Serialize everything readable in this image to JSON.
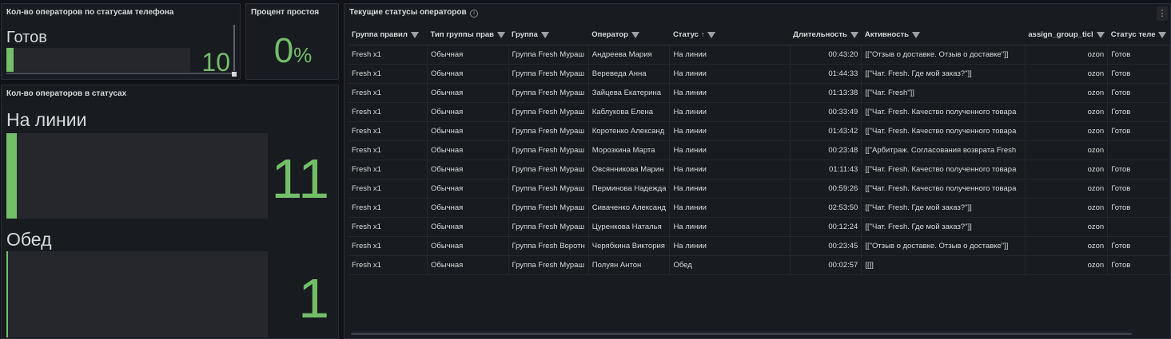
{
  "phone_panel": {
    "title": "Кол-во операторов по статусам телефона",
    "label": "Готов",
    "value": "10",
    "fill": 0.02
  },
  "idle_panel": {
    "title": "Процент простоя",
    "value": "0",
    "unit": "%"
  },
  "status_panel": {
    "title": "Кол-во операторов в статусах",
    "items": [
      {
        "label": "На линии",
        "value": "11",
        "fill": 0.04
      },
      {
        "label": "Обед",
        "value": "1",
        "fill": 0.004
      }
    ]
  },
  "table_panel": {
    "title": "Текущие статусы операторов",
    "info_icon": "info-icon",
    "columns": [
      "Группа правил",
      "Тип группы прав",
      "Группа",
      "Оператор",
      "Статус",
      "Длительность",
      "Активность",
      "assign_group_ticl",
      "Статус теле"
    ],
    "sort_column": "Статус",
    "rows": [
      [
        "Fresh x1",
        "Обычная",
        "Группа Fresh Мураш",
        "Андреева Мария",
        "На линии",
        "00:43:20",
        "[[\"Отзыв о доставке. Отзыв о доставке\"]]",
        "ozon",
        "Готов"
      ],
      [
        "Fresh x1",
        "Обычная",
        "Группа Fresh Мураш",
        "Вереведа Анна",
        "На линии",
        "01:44:33",
        "[[\"Чат. Fresh. Где мой заказ?\"]]",
        "ozon",
        "Готов"
      ],
      [
        "Fresh x1",
        "Обычная",
        "Группа Fresh Мураш",
        "Зайцева Екатерина",
        "На линии",
        "01:13:38",
        "[[\"Чат. Fresh\"]]",
        "ozon",
        "Готов"
      ],
      [
        "Fresh x1",
        "Обычная",
        "Группа Fresh Мураш",
        "Каблукова Елена",
        "На линии",
        "00:33:49",
        "[[\"Чат. Fresh. Качество полученного товара",
        "ozon",
        "Готов"
      ],
      [
        "Fresh x1",
        "Обычная",
        "Группа Fresh Мураш",
        "Коротенко Александ",
        "На линии",
        "01:43:42",
        "[[\"Чат. Fresh. Качество полученного товара",
        "ozon",
        "Готов"
      ],
      [
        "Fresh x1",
        "Обычная",
        "Группа Fresh Мураш",
        "Морозкина Марта",
        "На линии",
        "00:23:48",
        "[[\"Арбитраж. Согласования возврата Fresh",
        "ozon",
        ""
      ],
      [
        "Fresh x1",
        "Обычная",
        "Группа Fresh Мураш",
        "Овсянникова Марин",
        "На линии",
        "01:11:43",
        "[[\"Чат. Fresh. Качество полученного товара",
        "ozon",
        "Готов"
      ],
      [
        "Fresh x1",
        "Обычная",
        "Группа Fresh Мураш",
        "Перминова Надежда",
        "На линии",
        "00:59:26",
        "[[\"Чат. Fresh. Качество полученного товара",
        "ozon",
        "Готов"
      ],
      [
        "Fresh x1",
        "Обычная",
        "Группа Fresh Мураш",
        "Сиваченко Александ",
        "На линии",
        "02:53:50",
        "[[\"Чат. Fresh. Где мой заказ?\"]]",
        "ozon",
        "Готов"
      ],
      [
        "Fresh x1",
        "Обычная",
        "Группа Fresh Мураш",
        "Цуренкова Наталья",
        "На линии",
        "00:12:24",
        "[[\"Чат. Fresh. Где мой заказ?\"]]",
        "ozon",
        ""
      ],
      [
        "Fresh x1",
        "Обычная",
        "Группа Fresh Воротн",
        "Черябкина Виктория",
        "На линии",
        "00:23:45",
        "[[\"Отзыв о доставке. Отзыв о доставке\"]]",
        "ozon",
        "Готов"
      ],
      [
        "Fresh x1",
        "Обычная",
        "Группа Fresh Мураш",
        "Полуян Антон",
        "Обед",
        "00:02:57",
        "[[]]",
        "ozon",
        "Готов"
      ]
    ]
  },
  "colors": {
    "accent": "#73bf69",
    "background": "#111217",
    "panel": "#181b1f"
  }
}
